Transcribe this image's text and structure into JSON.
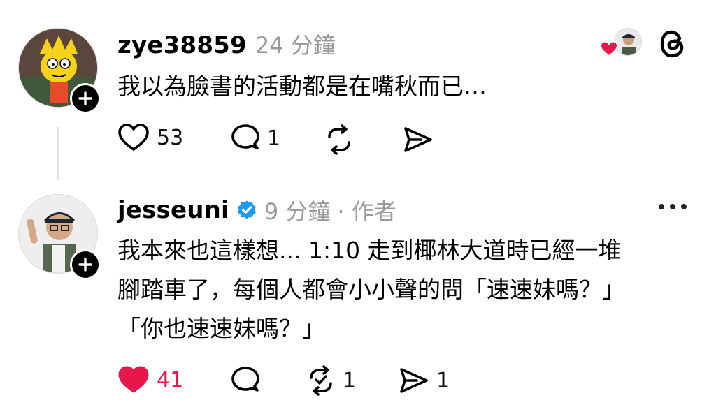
{
  "posts": [
    {
      "username": "zye38859",
      "time": "24 分鐘",
      "text": "我以為臉書的活動都是在嘴秋而已…",
      "likes": "53",
      "replies": "1",
      "liked": false
    },
    {
      "username": "jesseuni",
      "verified": true,
      "time": "9 分鐘",
      "author_tag": "· 作者",
      "text_lines": [
        "我本來也這樣想... 1:10 走到椰林大道時已經一堆",
        "腳踏車了，每個人都會小小聲的問「速速妹嗎？」",
        "「你也速速妹嗎？」"
      ],
      "likes": "41",
      "reposts": "1",
      "shares": "1",
      "liked": true
    }
  ],
  "colors": {
    "like_red": "#e8164b",
    "verified_blue": "#1d9bf0",
    "meta_gray": "#9a9a9a"
  },
  "icons": [
    "heart-icon",
    "comment-icon",
    "repost-icon",
    "share-icon",
    "threads-logo-icon",
    "more-icon",
    "plus-icon",
    "verified-badge-icon"
  ]
}
